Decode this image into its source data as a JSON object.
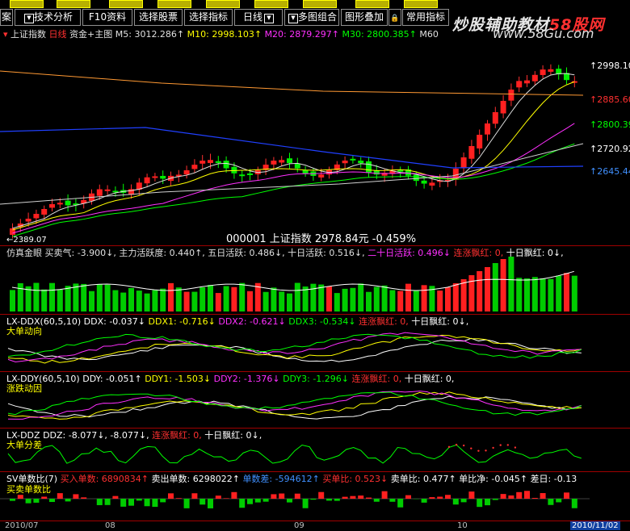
{
  "toolbar": {
    "items": [
      "案",
      "技术分析",
      "F10资料",
      "选择股票",
      "选择指标",
      "日线",
      "多图组合",
      "图形叠加",
      "常用指标"
    ],
    "lock": "🔒"
  },
  "brand": {
    "text1": "炒股辅助教材",
    "text2": "58股网",
    "site": "www.58Gu.com"
  },
  "main": {
    "index_name": "上证指数",
    "period": "日线",
    "template": "资金+主图",
    "ma5": "M5: 3012.286↑",
    "ma10": "M10: 2998.103↑",
    "ma20": "M20: 2879.297↑",
    "ma30": "M30: 2800.385↑",
    "ma60": "M60",
    "price_readout": "000001 上证指数 2978.84元 -0.459%",
    "low_label": "←2389.07",
    "right_labels": [
      "↑2998.10",
      "↑2885.60",
      "↑2800.39",
      "↑2720.92",
      "↑2645.44"
    ]
  },
  "panel1": {
    "name": "仿真金眼",
    "text": "买卖气: -3.900↓, 主力活跃度: 0.440↑, 五日活跃: 0.486↓, 十日活跃: 0.516↓,",
    "extra_mg": "二十日活跃: 0.496↓",
    "extra_rd": "连涨飘红: 0,",
    "extra_wh": "十日飘红: 0↓,"
  },
  "panel2": {
    "formula": "LX-DDX(60,5,10)",
    "ddx": "DDX: -0.037↓",
    "ddx1": "DDX1: -0.716↓",
    "ddx2": "DDX2: -0.621↓",
    "ddx3": "DDX3: -0.534↓",
    "lz": "连涨飘红: 0,",
    "sr": "十日飘红: 0↓,",
    "title": "大单动向"
  },
  "panel3": {
    "formula": "LX-DDY(60,5,10)",
    "ddy": "DDY: -0.051↑",
    "ddy1": "DDY1: -1.503↓",
    "ddy2": "DDY2: -1.376↓",
    "ddy3": "DDY3: -1.296↓",
    "lz": "连涨飘红: 0,",
    "sr": "十日飘红: 0,",
    "title": "涨跌动因"
  },
  "panel4": {
    "formula": "LX-DDZ",
    "ddz": "DDZ: -8.077↓, -8.077↓,",
    "lz": "连涨飘红: 0,",
    "sr": "十日飘红: 0↓,",
    "title": "大单分差"
  },
  "panel5": {
    "formula": "SV单数比(7)",
    "buy": "买入单数: 6890834↑",
    "sell": "卖出单数: 6298022↑",
    "diff": "单数差: -594612↑",
    "buyr": "买单比: 0.523↓",
    "sellr": "卖单比: 0.477↑",
    "net": "单比净: -0.045↑",
    "lag": "差日: -0.13",
    "title": "买卖单数比"
  },
  "dates": [
    "2010/07",
    "08",
    "09",
    "10",
    "2010/11/02"
  ],
  "chart_data": {
    "type": "candlestick",
    "title": "上证指数 日线",
    "right_axis_marks": [
      2998.1,
      2885.6,
      2800.39,
      2720.92,
      2645.44
    ],
    "low": 2389.07,
    "last_close": 2978.84,
    "change_pct": -0.459,
    "ma": {
      "M5": 3012.286,
      "M10": 2998.103,
      "M20": 2879.297,
      "M30": 2800.385
    },
    "x_labels": [
      "2010/07",
      "08",
      "09",
      "10",
      "2010/11/02"
    ]
  }
}
